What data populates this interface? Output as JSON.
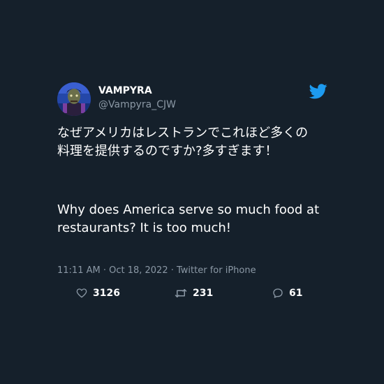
{
  "tweet": {
    "display_name": "VAMPYRA",
    "handle": "@Vampyra_CJW",
    "text_jp": "なぜアメリカはレストランでこれほど多くの料理を提供するのですか?多すぎます！",
    "text_en": "Why does America serve so much food at restaurants? It is too much!",
    "meta": "11:11 AM · Oct 18, 2022 · Twitter for iPhone",
    "likes": "3126",
    "retweets": "231",
    "replies": "61"
  },
  "icons": {
    "brand": "twitter-bird-icon",
    "like": "heart-icon",
    "retweet": "retweet-icon",
    "reply": "reply-icon"
  },
  "colors": {
    "background": "#15202b",
    "text": "#ffffff",
    "secondary_text": "#8b98a5",
    "twitter_blue": "#1d9bf0"
  }
}
